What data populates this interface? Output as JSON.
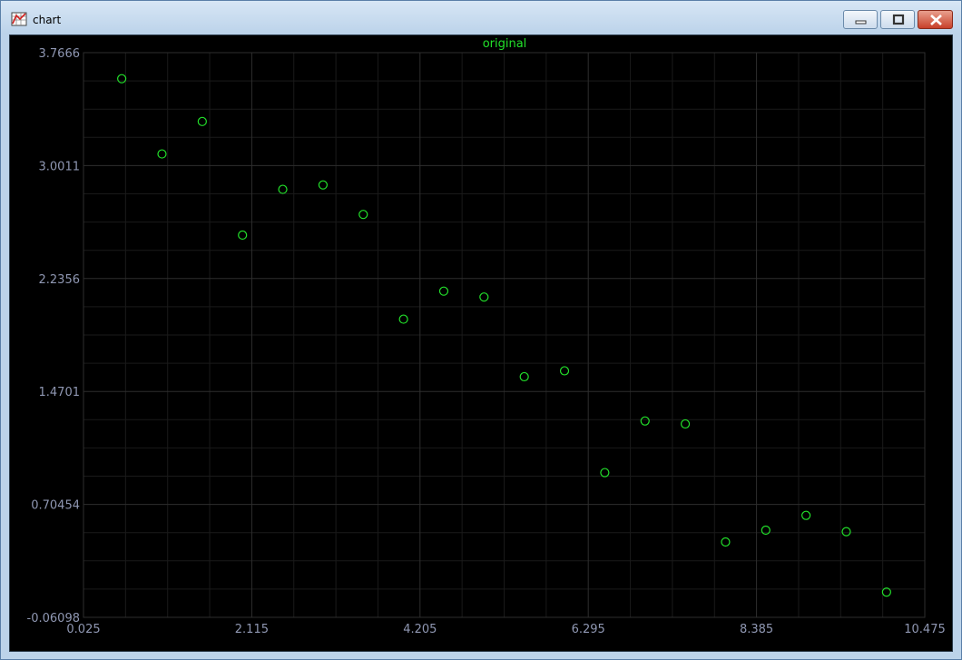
{
  "window": {
    "title": "chart",
    "icon": "chart-app-icon",
    "controls": [
      "minimize-icon",
      "maximize-icon",
      "close-icon"
    ]
  },
  "colors": {
    "background": "#000000",
    "grid_major": "#2e2e2e",
    "grid_minor": "#1a1a1a",
    "tick_text": "#8f97b2",
    "series": "#22e02a"
  },
  "chart_data": {
    "type": "scatter",
    "title": "original",
    "xlabel": "",
    "ylabel": "",
    "xlim": [
      0.025,
      10.475
    ],
    "ylim": [
      -0.06098,
      3.7666
    ],
    "xticks": [
      "0.025",
      "2.115",
      "4.205",
      "6.295",
      "8.385",
      "10.475"
    ],
    "yticks": [
      "3.7666",
      "3.0011",
      "2.2356",
      "1.4701",
      "0.70454",
      "-0.06098"
    ],
    "grid": true,
    "marker": "hollow-circle",
    "series": [
      {
        "x": [
          0.5,
          1.0,
          1.5,
          2.0,
          2.5,
          3.0,
          3.5,
          4.0,
          4.5,
          5.0,
          5.5,
          6.0,
          6.5,
          7.0,
          7.5,
          8.0,
          8.5,
          9.0,
          9.5,
          10.0
        ],
        "y": [
          3.59,
          3.08,
          3.3,
          2.53,
          2.84,
          2.87,
          2.67,
          1.96,
          2.15,
          2.11,
          1.57,
          1.61,
          0.92,
          1.27,
          1.25,
          0.45,
          0.53,
          0.63,
          0.52,
          0.11
        ]
      }
    ]
  }
}
